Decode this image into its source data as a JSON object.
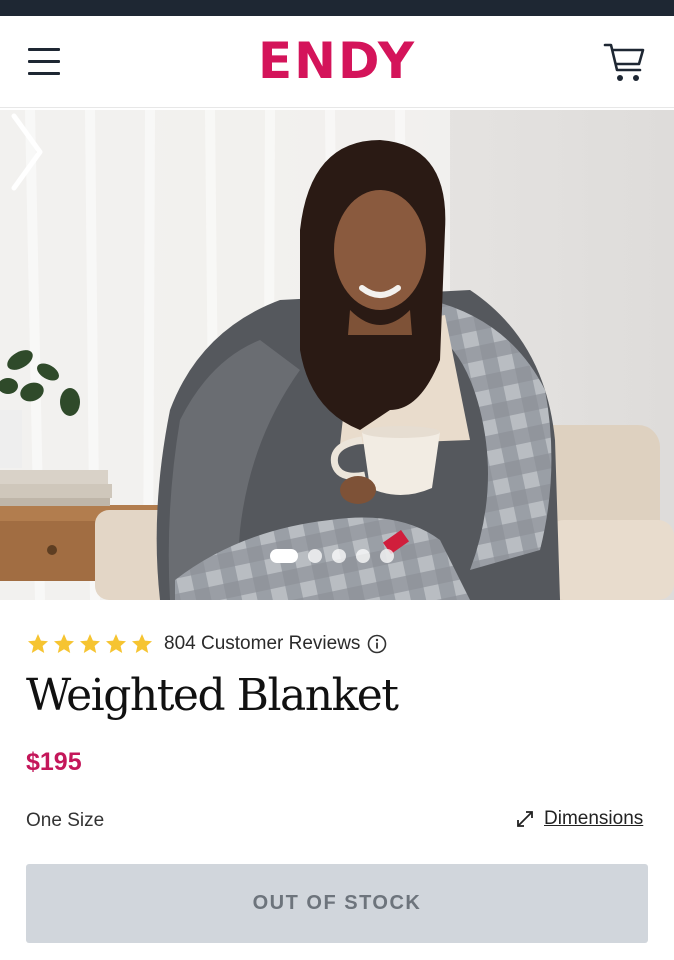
{
  "header": {
    "brand": "ENDY",
    "menu_icon": "hamburger-menu-icon",
    "cart_icon": "shopping-cart-icon"
  },
  "hero": {
    "carousel_total": 5,
    "carousel_active": 1,
    "next_icon": "chevron-right-icon"
  },
  "product": {
    "rating": 5,
    "reviews_label": "804 Customer Reviews",
    "title": "Weighted Blanket",
    "price": "$195",
    "size_label": "One Size",
    "dimensions_label": "Dimensions",
    "stock_button": "OUT OF STOCK"
  },
  "colors": {
    "brand": "#d4145a",
    "price": "#c4175a",
    "star": "#f6c431",
    "button_bg": "#d1d6dc"
  }
}
